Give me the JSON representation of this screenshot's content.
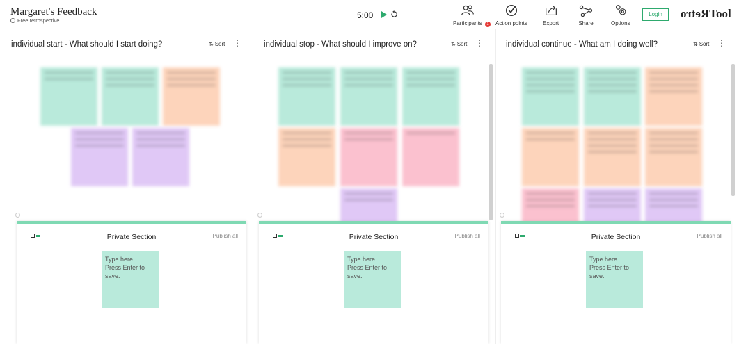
{
  "header": {
    "title": "Margaret's Feedback",
    "subtitle": "Free retrospective",
    "timer": "5:00",
    "tools": [
      {
        "label": "Participants",
        "badge": "1"
      },
      {
        "label": "Action points"
      },
      {
        "label": "Export"
      },
      {
        "label": "Share"
      },
      {
        "label": "Options"
      }
    ],
    "login_label": "Login",
    "logo_mirrored": "Retro",
    "logo_plain": "Tool"
  },
  "columns": [
    {
      "title": "individual start - What should I start doing?",
      "sort_label": "Sort",
      "private": {
        "title": "Private Section",
        "publish_label": "Publish all",
        "placeholder": "Type here... Press Enter to save."
      }
    },
    {
      "title": "individual stop - What should I improve on?",
      "sort_label": "Sort",
      "private": {
        "title": "Private Section",
        "publish_label": "Publish all",
        "placeholder": "Type here... Press Enter to save."
      }
    },
    {
      "title": "individual continue - What am I doing well?",
      "sort_label": "Sort",
      "private": {
        "title": "Private Section",
        "publish_label": "Publish all",
        "placeholder": "Type here... Press Enter to save."
      }
    }
  ],
  "colors": {
    "accent": "#2eaa6e",
    "note_mint": "#b9eadb",
    "note_peach": "#fdd4bb",
    "note_pink": "#fbc1cf",
    "note_lavender": "#e0c8f6",
    "badge": "#e53935"
  },
  "icons": [
    "info-icon",
    "play-icon",
    "reset-icon",
    "participants-icon",
    "action-points-icon",
    "export-icon",
    "share-icon",
    "options-icon",
    "sort-icon",
    "kebab-icon",
    "private-section-icon"
  ]
}
